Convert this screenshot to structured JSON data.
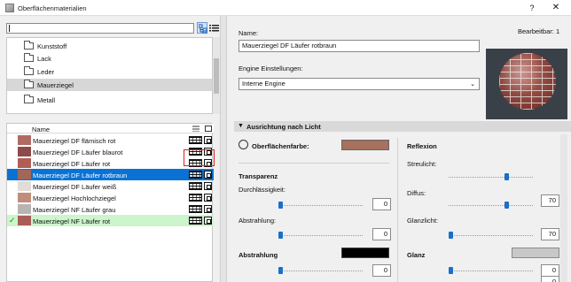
{
  "window": {
    "title": "Oberflächenmaterialien",
    "help": "?",
    "close": "✕"
  },
  "search": {
    "value": ""
  },
  "tree": {
    "items": [
      {
        "label": "Kunststoff"
      },
      {
        "label": "Lack"
      },
      {
        "label": "Leder"
      },
      {
        "label": "Mauerziegel",
        "selected": true
      },
      {
        "label": "Metall"
      }
    ]
  },
  "list": {
    "header": "Name",
    "rows": [
      {
        "label": "Mauerziegel DF flämisch rot",
        "swatch": "#b06a62"
      },
      {
        "label": "Mauerziegel DF Läufer blaurot",
        "swatch": "#8c4a4a"
      },
      {
        "label": "Mauerziegel DF Läufer rot",
        "swatch": "#b15d55"
      },
      {
        "label": "Mauerziegel DF Läufer rotbraun",
        "swatch": "#a0685a",
        "selected": true
      },
      {
        "label": "Mauerziegel DF Läufer weiß",
        "swatch": "#e3dcd6"
      },
      {
        "label": "Mauerziegel Hochlochziegel",
        "swatch": "#c08d7a"
      },
      {
        "label": "Mauerziegel NF Läufer grau",
        "swatch": "#b8b4b2"
      },
      {
        "label": "Mauerziegel NF Läufer rot",
        "swatch": "#a85e56",
        "checked": true
      }
    ]
  },
  "details": {
    "name_label": "Name:",
    "name_value": "Mauerziegel DF Läufer rotbraun",
    "editable_label": "Bearbeitbar: 1",
    "engine_label": "Engine Einstellungen:",
    "engine_value": "Interne Engine",
    "section_title": "Ausrichtung nach Licht",
    "surface_color_label": "Oberflächenfarbe:",
    "surface_color": "#a8705e",
    "transparency_label": "Transparenz",
    "permeability_label": "Durchlässigkeit:",
    "permeability_value": "0",
    "emission_label": "Abstrahlung:",
    "emission_value": "0",
    "emission2_label": "Abstrahlung",
    "emission2_value": "0",
    "emission_color": "#000000",
    "reflection_label": "Reflexion",
    "diffuse_light_label": "Streulicht:",
    "diffuse_light_value": "70",
    "diffuse_label": "Diffus:",
    "diffuse_value": "70",
    "specular_label": "Glanzlicht:",
    "specular_value": "0",
    "gloss_label": "Glanz",
    "gloss_value": "0",
    "gloss_color": "#c8c8c8"
  }
}
